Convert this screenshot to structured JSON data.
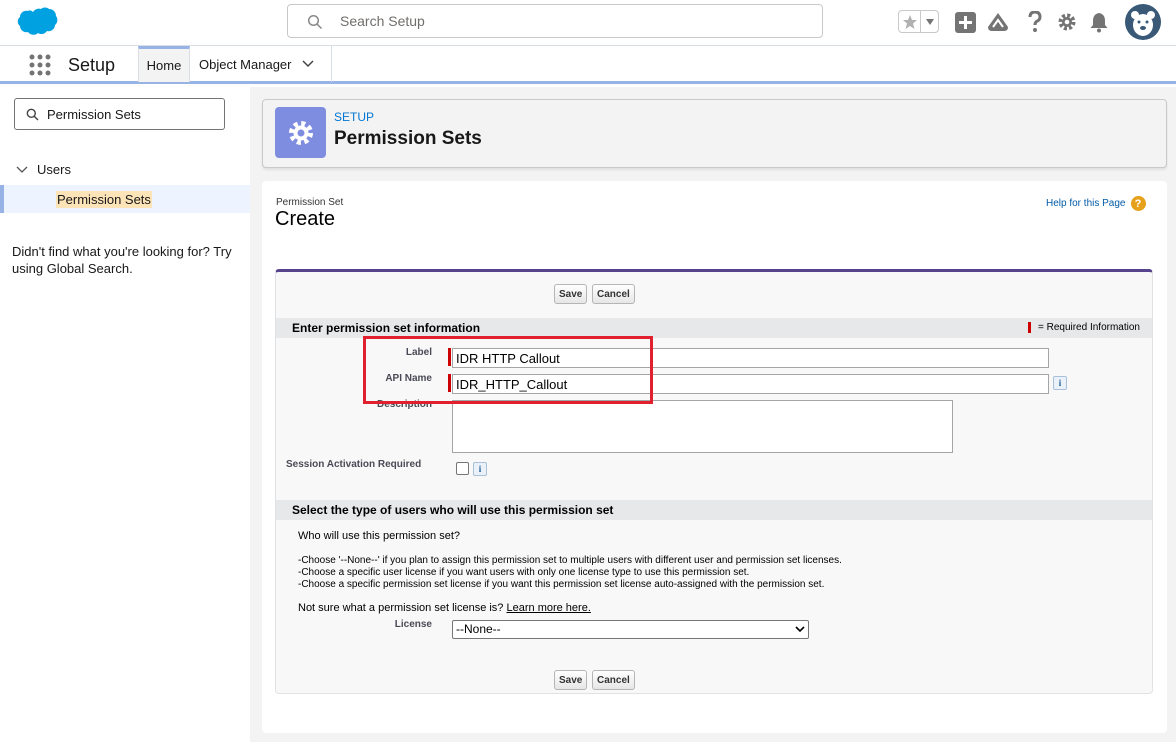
{
  "header": {
    "search_placeholder": "Search Setup"
  },
  "nav": {
    "app_name": "Setup",
    "tabs": [
      {
        "label": "Home"
      },
      {
        "label": "Object Manager"
      }
    ]
  },
  "sidebar": {
    "quick_find_value": "Permission Sets",
    "tree_parent": "Users",
    "tree_selected": "Permission Sets",
    "not_found_text": "Didn't find what you're looking for? Try using Global Search."
  },
  "page_header": {
    "eyebrow": "SETUP",
    "title": "Permission Sets"
  },
  "form": {
    "subtitle": "Permission Set",
    "title": "Create",
    "help_link": "Help for this Page",
    "save_label": "Save",
    "cancel_label": "Cancel",
    "section1_title": "Enter permission set information",
    "required_legend": "= Required Information",
    "label_label": "Label",
    "label_value": "IDR HTTP Callout",
    "api_name_label": "API Name",
    "api_name_value": "IDR_HTTP_Callout",
    "description_label": "Description",
    "session_label": "Session Activation Required",
    "section2_title": "Select the type of users who will use this permission set",
    "who_question": "Who will use this permission set?",
    "choice_1": "-Choose '--None--' if you plan to assign this permission set to multiple users with different user and permission set licenses.",
    "choice_2": "-Choose a specific user license if you want users with only one license type to use this permission set.",
    "choice_3": "-Choose a specific permission set license if you want this permission set license auto-assigned with the permission set.",
    "not_sure_text": "Not sure what a permission set license is?",
    "learn_more": "Learn more here.",
    "license_label": "License",
    "license_selected": "--None--"
  },
  "colors": {
    "brand_blue": "#00a1e0",
    "page_header_icon": "#7f8de1",
    "highlight_box": "#e0202f",
    "required_marker": "#cc0000"
  }
}
